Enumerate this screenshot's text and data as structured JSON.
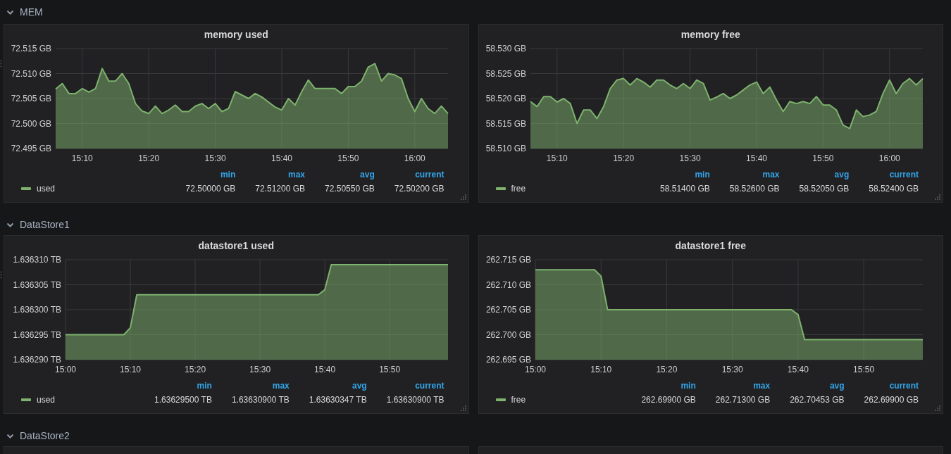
{
  "rows": [
    {
      "title": "MEM",
      "expanded": true,
      "panels": [
        {
          "kind": "graph",
          "title": "memory used",
          "chart_data": {
            "type": "area",
            "categories": [
              null,
              null,
              null,
              null,
              "15:10",
              null,
              null,
              null,
              null,
              null,
              null,
              null,
              null,
              null,
              "15:20",
              null,
              null,
              null,
              null,
              null,
              null,
              null,
              null,
              null,
              "15:30",
              null,
              null,
              null,
              null,
              null,
              null,
              null,
              null,
              null,
              "15:40",
              null,
              null,
              null,
              null,
              null,
              null,
              null,
              null,
              null,
              "15:50",
              null,
              null,
              null,
              null,
              null,
              null,
              null,
              null,
              null,
              "16:00",
              null,
              null,
              null,
              null,
              null
            ],
            "series": [
              {
                "name": "used",
                "color": "#7eb26d",
                "values": [
                  72.5069,
                  72.508,
                  72.506,
                  72.506,
                  72.507,
                  72.5063,
                  72.507,
                  72.511,
                  72.5085,
                  72.5085,
                  72.51,
                  72.508,
                  72.504,
                  72.5025,
                  72.502,
                  72.5035,
                  72.502,
                  72.5027,
                  72.5037,
                  72.5024,
                  72.5024,
                  72.5035,
                  72.504,
                  72.503,
                  72.504,
                  72.5024,
                  72.503,
                  72.5064,
                  72.5057,
                  72.505,
                  72.506,
                  72.5053,
                  72.5043,
                  72.5033,
                  72.5027,
                  72.505,
                  72.5037,
                  72.5064,
                  72.5087,
                  72.507,
                  72.507,
                  72.507,
                  72.507,
                  72.506,
                  72.5074,
                  72.5074,
                  72.5085,
                  72.5113,
                  72.512,
                  72.5085,
                  72.51,
                  72.5097,
                  72.509,
                  72.505,
                  72.5024,
                  72.505,
                  72.503,
                  72.502,
                  72.5035,
                  72.502
                ]
              }
            ],
            "grid": true,
            "ylim": [
              72.495,
              72.515
            ],
            "yticks": [
              {
                "value": 72.495,
                "label": "72.495 GB"
              },
              {
                "value": 72.5,
                "label": "72.500 GB"
              },
              {
                "value": 72.505,
                "label": "72.505 GB"
              },
              {
                "value": 72.51,
                "label": "72.510 GB"
              },
              {
                "value": 72.515,
                "label": "72.515 GB"
              }
            ]
          },
          "legend": {
            "headers": [
              "min",
              "max",
              "avg",
              "current"
            ],
            "values": [
              [
                "72.50000 GB",
                "72.51200 GB",
                "72.50550 GB",
                "72.50200 GB"
              ]
            ]
          }
        },
        {
          "kind": "graph",
          "title": "memory free",
          "chart_data": {
            "type": "area",
            "categories": [
              null,
              null,
              null,
              null,
              "15:10",
              null,
              null,
              null,
              null,
              null,
              null,
              null,
              null,
              null,
              "15:20",
              null,
              null,
              null,
              null,
              null,
              null,
              null,
              null,
              null,
              "15:30",
              null,
              null,
              null,
              null,
              null,
              null,
              null,
              null,
              null,
              "15:40",
              null,
              null,
              null,
              null,
              null,
              null,
              null,
              null,
              null,
              "15:50",
              null,
              null,
              null,
              null,
              null,
              null,
              null,
              null,
              null,
              "16:00",
              null,
              null,
              null,
              null,
              null
            ],
            "series": [
              {
                "name": "free",
                "color": "#7eb26d",
                "values": [
                  58.5194,
                  58.5184,
                  58.5204,
                  58.5204,
                  58.5193,
                  58.52,
                  58.519,
                  58.515,
                  58.5177,
                  58.5177,
                  58.516,
                  58.5184,
                  58.522,
                  58.5237,
                  58.524,
                  58.5227,
                  58.524,
                  58.5233,
                  58.5223,
                  58.5237,
                  58.5237,
                  58.5227,
                  58.522,
                  58.523,
                  58.522,
                  58.5237,
                  58.523,
                  58.5197,
                  58.5203,
                  58.521,
                  58.52,
                  58.5207,
                  58.5217,
                  58.5227,
                  58.5233,
                  58.521,
                  58.5223,
                  58.5197,
                  58.5174,
                  58.5194,
                  58.519,
                  58.5194,
                  58.519,
                  58.5204,
                  58.5187,
                  58.5187,
                  58.5177,
                  58.5147,
                  58.514,
                  58.5177,
                  58.5164,
                  58.5167,
                  58.5174,
                  58.521,
                  58.5237,
                  58.521,
                  58.523,
                  58.524,
                  58.5227,
                  58.524
                ]
              }
            ],
            "grid": true,
            "ylim": [
              58.51,
              58.53
            ],
            "yticks": [
              {
                "value": 58.51,
                "label": "58.510 GB"
              },
              {
                "value": 58.515,
                "label": "58.515 GB"
              },
              {
                "value": 58.52,
                "label": "58.520 GB"
              },
              {
                "value": 58.525,
                "label": "58.525 GB"
              },
              {
                "value": 58.53,
                "label": "58.530 GB"
              }
            ]
          },
          "legend": {
            "headers": [
              "min",
              "max",
              "avg",
              "current"
            ],
            "values": [
              [
                "58.51400 GB",
                "58.52600 GB",
                "58.52050 GB",
                "58.52400 GB"
              ]
            ]
          }
        }
      ]
    },
    {
      "title": "DataStore1",
      "expanded": true,
      "panels": [
        {
          "kind": "graph",
          "title": "datastore1 used",
          "chart_data": {
            "type": "area",
            "categories": [
              "15:00",
              null,
              null,
              null,
              null,
              null,
              null,
              null,
              null,
              null,
              "15:10",
              null,
              null,
              null,
              null,
              null,
              null,
              null,
              null,
              null,
              "15:20",
              null,
              null,
              null,
              null,
              null,
              null,
              null,
              null,
              null,
              "15:30",
              null,
              null,
              null,
              null,
              null,
              null,
              null,
              null,
              null,
              "15:40",
              null,
              null,
              null,
              null,
              null,
              null,
              null,
              null,
              null,
              "15:50",
              null,
              null,
              null,
              null,
              null,
              null,
              null,
              null,
              null
            ],
            "series": [
              {
                "name": "used",
                "color": "#7eb26d",
                "values": [
                  1.636295,
                  1.636295,
                  1.636295,
                  1.636295,
                  1.636295,
                  1.636295,
                  1.636295,
                  1.636295,
                  1.636295,
                  1.636295,
                  1.6362964,
                  1.636303,
                  1.636303,
                  1.636303,
                  1.636303,
                  1.636303,
                  1.636303,
                  1.636303,
                  1.636303,
                  1.636303,
                  1.636303,
                  1.636303,
                  1.636303,
                  1.636303,
                  1.636303,
                  1.636303,
                  1.636303,
                  1.636303,
                  1.636303,
                  1.636303,
                  1.636303,
                  1.636303,
                  1.636303,
                  1.636303,
                  1.636303,
                  1.636303,
                  1.636303,
                  1.636303,
                  1.636303,
                  1.636303,
                  1.636304,
                  1.636309,
                  1.636309,
                  1.636309,
                  1.636309,
                  1.636309,
                  1.636309,
                  1.636309,
                  1.636309,
                  1.636309,
                  1.636309,
                  1.636309,
                  1.636309,
                  1.636309,
                  1.636309,
                  1.636309,
                  1.636309,
                  1.636309,
                  1.636309,
                  1.636309
                ]
              }
            ],
            "grid": true,
            "ylim": [
              1.63629,
              1.63631
            ],
            "yticks": [
              {
                "value": 1.63629,
                "label": "1.636290 TB"
              },
              {
                "value": 1.636295,
                "label": "1.636295 TB"
              },
              {
                "value": 1.6363,
                "label": "1.636300 TB"
              },
              {
                "value": 1.636305,
                "label": "1.636305 TB"
              },
              {
                "value": 1.63631,
                "label": "1.636310 TB"
              }
            ]
          },
          "legend": {
            "headers": [
              "min",
              "max",
              "avg",
              "current"
            ],
            "values": [
              [
                "1.63629500 TB",
                "1.63630900 TB",
                "1.63630347 TB",
                "1.63630900 TB"
              ]
            ]
          }
        },
        {
          "kind": "graph",
          "title": "datastore1 free",
          "chart_data": {
            "type": "area",
            "categories": [
              "15:00",
              null,
              null,
              null,
              null,
              null,
              null,
              null,
              null,
              null,
              "15:10",
              null,
              null,
              null,
              null,
              null,
              null,
              null,
              null,
              null,
              "15:20",
              null,
              null,
              null,
              null,
              null,
              null,
              null,
              null,
              null,
              "15:30",
              null,
              null,
              null,
              null,
              null,
              null,
              null,
              null,
              null,
              "15:40",
              null,
              null,
              null,
              null,
              null,
              null,
              null,
              null,
              null,
              "15:50",
              null,
              null,
              null,
              null,
              null,
              null,
              null,
              null,
              null
            ],
            "series": [
              {
                "name": "free",
                "color": "#7eb26d",
                "values": [
                  262.713,
                  262.713,
                  262.713,
                  262.713,
                  262.713,
                  262.713,
                  262.713,
                  262.713,
                  262.713,
                  262.713,
                  262.7117,
                  262.705,
                  262.705,
                  262.705,
                  262.705,
                  262.705,
                  262.705,
                  262.705,
                  262.705,
                  262.705,
                  262.705,
                  262.705,
                  262.705,
                  262.705,
                  262.705,
                  262.705,
                  262.705,
                  262.705,
                  262.705,
                  262.705,
                  262.705,
                  262.705,
                  262.705,
                  262.705,
                  262.705,
                  262.705,
                  262.705,
                  262.705,
                  262.705,
                  262.705,
                  262.704,
                  262.699,
                  262.699,
                  262.699,
                  262.699,
                  262.699,
                  262.699,
                  262.699,
                  262.699,
                  262.699,
                  262.699,
                  262.699,
                  262.699,
                  262.699,
                  262.699,
                  262.699,
                  262.699,
                  262.699,
                  262.699,
                  262.699
                ]
              }
            ],
            "grid": true,
            "ylim": [
              262.695,
              262.715
            ],
            "yticks": [
              {
                "value": 262.695,
                "label": "262.695 GB"
              },
              {
                "value": 262.7,
                "label": "262.700 GB"
              },
              {
                "value": 262.705,
                "label": "262.705 GB"
              },
              {
                "value": 262.71,
                "label": "262.710 GB"
              },
              {
                "value": 262.715,
                "label": "262.715 GB"
              }
            ]
          },
          "legend": {
            "headers": [
              "min",
              "max",
              "avg",
              "current"
            ],
            "values": [
              [
                "262.69900 GB",
                "262.71300 GB",
                "262.70453 GB",
                "262.69900 GB"
              ]
            ]
          }
        }
      ]
    },
    {
      "title": "DataStore2",
      "expanded": true,
      "panels": [
        {
          "kind": "stub"
        },
        {
          "kind": "stub"
        }
      ]
    }
  ]
}
